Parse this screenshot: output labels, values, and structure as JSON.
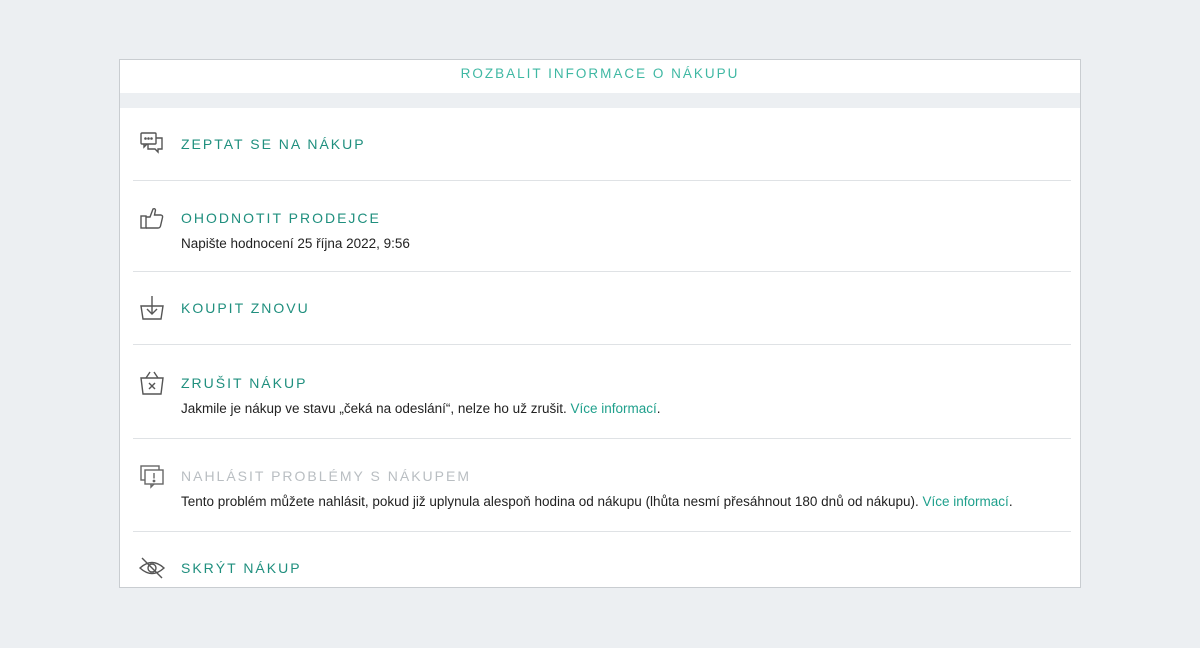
{
  "expand_label": "ROZBALIT INFORMACE O NÁKUPU",
  "colors": {
    "accent": "#1f8f7e",
    "link": "#1fa08c",
    "expand": "#3fb8a3",
    "disabled": "#b9bec2",
    "background": "#eceff2"
  },
  "actions": [
    {
      "icon": "chat-bubbles-icon",
      "title": "ZEPTAT SE NA NÁKUP"
    },
    {
      "icon": "thumbs-up-icon",
      "title": "OHODNOTIT PRODEJCE",
      "desc": "Napište hodnocení 25 října 2022, 9:56"
    },
    {
      "icon": "basket-download-icon",
      "title": "KOUPIT ZNOVU"
    },
    {
      "icon": "basket-cancel-icon",
      "title": "ZRUŠIT NÁKUP",
      "desc": "Jakmile je nákup ve stavu „čeká na odeslání“, nelze ho už zrušit.",
      "link": "Více informací",
      "suffix": "."
    },
    {
      "icon": "report-problem-icon",
      "title": "NAHLÁSIT PROBLÉMY S NÁKUPEM",
      "disabled": true,
      "desc": "Tento problém můžete nahlásit, pokud již uplynula alespoň hodina od nákupu (lhůta nesmí přesáhnout 180 dnů od nákupu).",
      "link": "Více informací",
      "suffix": "."
    },
    {
      "icon": "eye-off-icon",
      "title": "SKRÝT NÁKUP"
    }
  ]
}
